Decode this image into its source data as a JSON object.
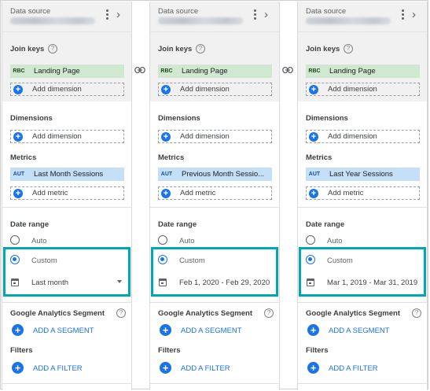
{
  "panels": [
    {
      "datasource_label": "Data source",
      "join_keys_title": "Join keys",
      "join_key": {
        "type": "RBC",
        "name": "Landing Page"
      },
      "add_dimension_label": "Add dimension",
      "dimensions_title": "Dimensions",
      "dimensions_add_label": "Add dimension",
      "metrics_title": "Metrics",
      "metric": {
        "type": "AUT",
        "name": "Last Month Sessions"
      },
      "add_metric_label": "Add metric",
      "date_range_title": "Date range",
      "auto_label": "Auto",
      "custom_label": "Custom",
      "date_value": "Last month",
      "segment_title": "Google Analytics Segment",
      "add_segment_label": "ADD A SEGMENT",
      "filters_title": "Filters",
      "add_filter_label": "ADD A FILTER"
    },
    {
      "datasource_label": "Data source",
      "join_keys_title": "Join keys",
      "join_key": {
        "type": "RBC",
        "name": "Landing Page"
      },
      "add_dimension_label": "Add dimension",
      "dimensions_title": "Dimensions",
      "dimensions_add_label": "Add dimension",
      "metrics_title": "Metrics",
      "metric": {
        "type": "AUT",
        "name": "Previous Month Sessio..."
      },
      "add_metric_label": "Add metric",
      "date_range_title": "Date range",
      "auto_label": "Auto",
      "custom_label": "Custom",
      "date_value": "Feb 1, 2020 - Feb 29, 2020",
      "segment_title": "Google Analytics Segment",
      "add_segment_label": "ADD A SEGMENT",
      "filters_title": "Filters",
      "add_filter_label": "ADD A FILTER"
    },
    {
      "datasource_label": "Data source",
      "join_keys_title": "Join keys",
      "join_key": {
        "type": "RBC",
        "name": "Landing Page"
      },
      "add_dimension_label": "Add dimension",
      "dimensions_title": "Dimensions",
      "dimensions_add_label": "Add dimension",
      "metrics_title": "Metrics",
      "metric": {
        "type": "AUT",
        "name": "Last Year Sessions"
      },
      "add_metric_label": "Add metric",
      "date_range_title": "Date range",
      "auto_label": "Auto",
      "custom_label": "Custom",
      "date_value": "Mar 1, 2019 - Mar 31, 2019",
      "segment_title": "Google Analytics Segment",
      "add_segment_label": "ADD A SEGMENT",
      "filters_title": "Filters",
      "add_filter_label": "ADD A FILTER"
    }
  ],
  "colors": {
    "accent": "#1a73e8",
    "highlight": "#00a8b5",
    "dimension_chip": "#cfe8cf",
    "metric_chip": "#c5dff6"
  }
}
